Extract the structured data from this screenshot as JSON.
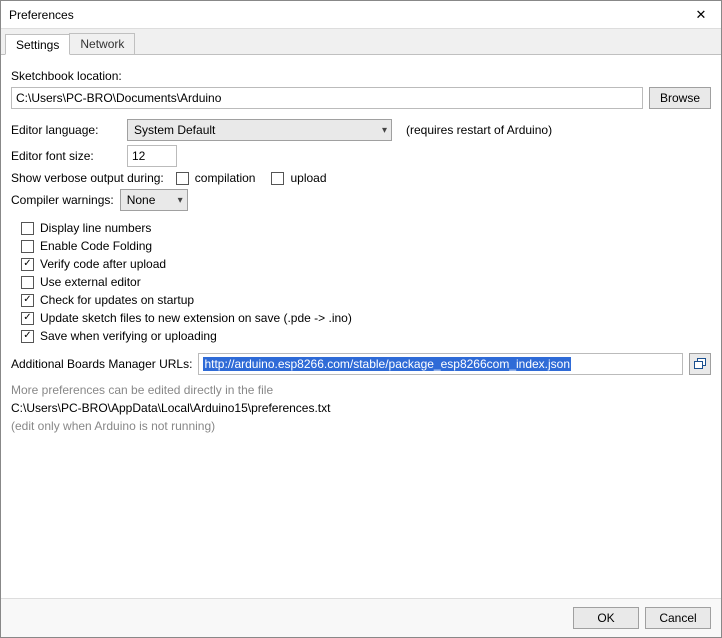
{
  "window": {
    "title": "Preferences"
  },
  "tabs": {
    "settings": "Settings",
    "network": "Network"
  },
  "sketchbook": {
    "label": "Sketchbook location:",
    "value": "C:\\Users\\PC-BRO\\Documents\\Arduino",
    "browse": "Browse"
  },
  "language": {
    "label": "Editor language:",
    "value": "System Default",
    "hint": "(requires restart of Arduino)"
  },
  "fontsize": {
    "label": "Editor font size:",
    "value": "12"
  },
  "verbose": {
    "label": "Show verbose output during:",
    "compilation": "compilation",
    "upload": "upload"
  },
  "compilerWarnings": {
    "label": "Compiler warnings:",
    "value": "None"
  },
  "checks": {
    "displayLineNumbers": {
      "label": "Display line numbers",
      "checked": false
    },
    "enableCodeFolding": {
      "label": "Enable Code Folding",
      "checked": false
    },
    "verifyAfterUpload": {
      "label": "Verify code after upload",
      "checked": true
    },
    "useExternalEditor": {
      "label": "Use external editor",
      "checked": false
    },
    "checkUpdates": {
      "label": "Check for updates on startup",
      "checked": true
    },
    "updateExtension": {
      "label": "Update sketch files to new extension on save (.pde -> .ino)",
      "checked": true
    },
    "saveWhenVerify": {
      "label": "Save when verifying or uploading",
      "checked": true
    }
  },
  "boardsUrl": {
    "label": "Additional Boards Manager URLs:",
    "value": "http://arduino.esp8266.com/stable/package_esp8266com_index.json"
  },
  "more": {
    "line1": "More preferences can be edited directly in the file",
    "path": "C:\\Users\\PC-BRO\\AppData\\Local\\Arduino15\\preferences.txt",
    "line2": "(edit only when Arduino is not running)"
  },
  "buttons": {
    "ok": "OK",
    "cancel": "Cancel"
  }
}
